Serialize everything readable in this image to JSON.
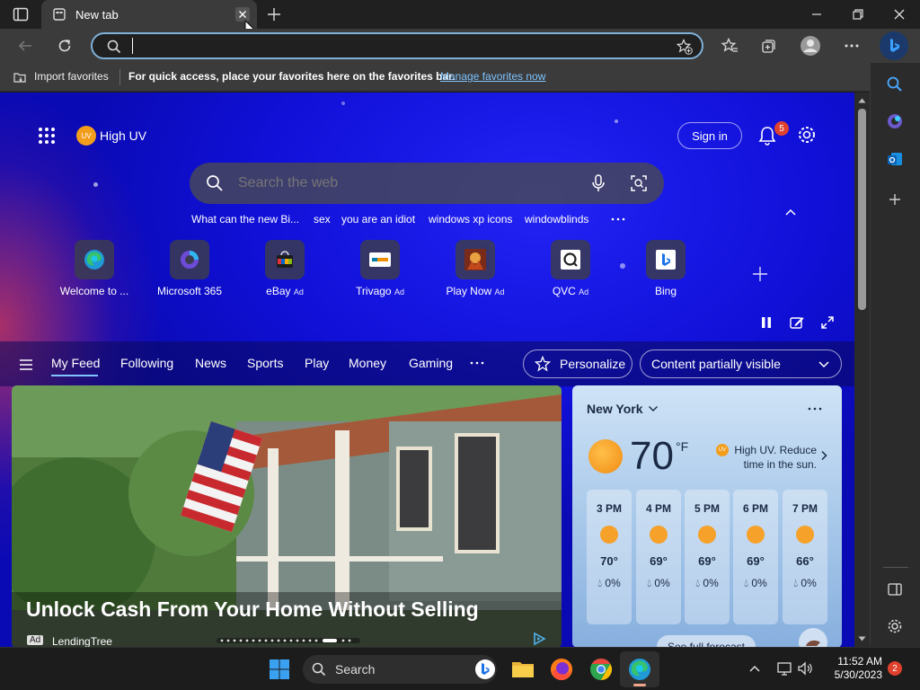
{
  "browser": {
    "tab_title": "New tab",
    "favorites_bar": {
      "import_label": "Import favorites",
      "message": "For quick access, place your favorites here on the favorites bar.",
      "manage_link": "Manage favorites now"
    },
    "address_bar": {
      "value": "",
      "placeholder": ""
    }
  },
  "newtab": {
    "weather_chip": {
      "badge": "UV",
      "label": "High UV"
    },
    "sign_in": "Sign in",
    "notification_count": "5",
    "search_placeholder": "Search the web",
    "suggestions": [
      "What can the new Bi...",
      "sex",
      "you are an idiot",
      "windows xp icons",
      "windowblinds"
    ],
    "quick_links": [
      {
        "label": "Welcome to ...",
        "ad": "",
        "icon": "edge-icon"
      },
      {
        "label": "Microsoft 365",
        "ad": "",
        "icon": "microsoft365-icon"
      },
      {
        "label": "eBay",
        "ad": "Ad",
        "icon": "ebay-icon"
      },
      {
        "label": "Trivago",
        "ad": "Ad",
        "icon": "trivago-icon"
      },
      {
        "label": "Play Now",
        "ad": "Ad",
        "icon": "game-icon"
      },
      {
        "label": "QVC",
        "ad": "Ad",
        "icon": "qvc-icon"
      },
      {
        "label": "Bing",
        "ad": "",
        "icon": "bing-icon"
      }
    ],
    "feed_tabs": [
      "My Feed",
      "Following",
      "News",
      "Sports",
      "Play",
      "Money",
      "Gaming"
    ],
    "personalize": "Personalize",
    "visibility": "Content partially visible",
    "hero": {
      "headline": "Unlock Cash From Your Home Without Selling",
      "ad_badge": "Ad",
      "sponsor": "LendingTree"
    },
    "weather": {
      "location": "New York",
      "temperature": "70",
      "unit": "°F",
      "uv_badge": "UV",
      "alert": "High UV. Reduce time in the sun.",
      "hourly": [
        {
          "time": "3 PM",
          "temp": "70°",
          "precip": "0%"
        },
        {
          "time": "4 PM",
          "temp": "69°",
          "precip": "0%"
        },
        {
          "time": "5 PM",
          "temp": "69°",
          "precip": "0%"
        },
        {
          "time": "6 PM",
          "temp": "69°",
          "precip": "0%"
        },
        {
          "time": "7 PM",
          "temp": "66°",
          "precip": "0%"
        }
      ],
      "forecast_link": "See full forecast"
    }
  },
  "taskbar": {
    "search_label": "Search",
    "time": "11:52 AM",
    "date": "5/30/2023",
    "notification_count": "2"
  },
  "colors": {
    "newtab_background": "#1010d8",
    "accent_link": "#7fc3ff",
    "notification_badge": "#e0412d"
  }
}
